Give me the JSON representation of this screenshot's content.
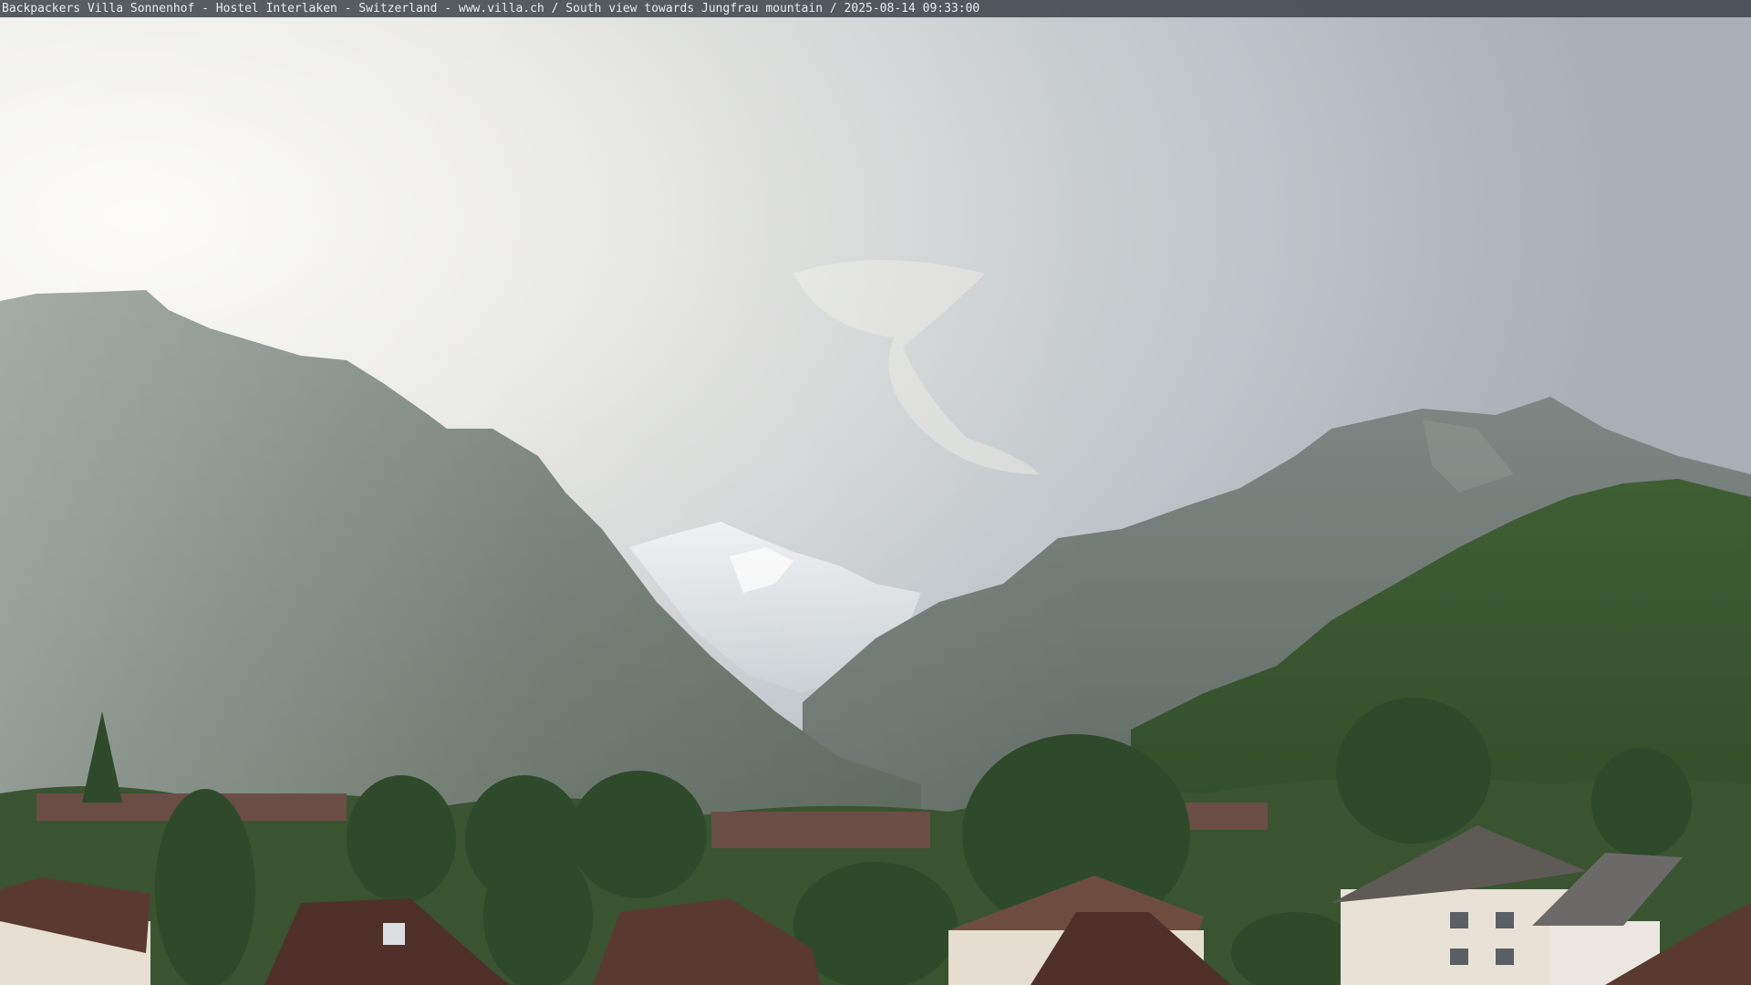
{
  "caption": "Backpackers Villa Sonnenhof - Hostel Interlaken - Switzerland - www.villa.ch / South view towards Jungfrau mountain / 2025-08-14 09:33:00",
  "scene": {
    "colors": {
      "sky_bright": "#f6f4ee",
      "sky_mid": "#c9ced2",
      "sky_right": "#a9b0b6",
      "mountain_left": "#5e6a62",
      "mountain_right": "#6d7770",
      "snow_peak": "#e7eaee",
      "forest": "#3e5a33",
      "trees_dark": "#2f4a2a",
      "roof": "#5a3a30",
      "house_wall": "#e8e2d6"
    }
  }
}
